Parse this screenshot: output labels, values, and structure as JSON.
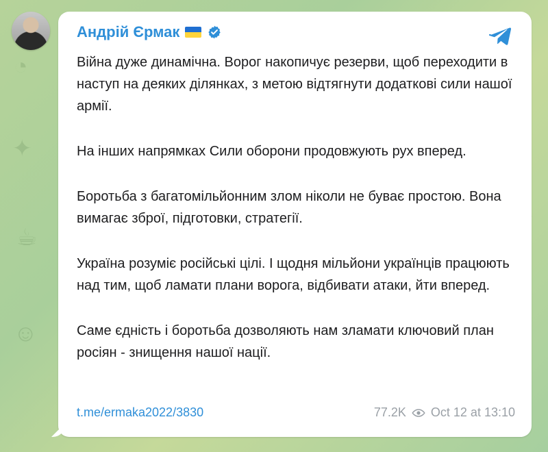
{
  "post": {
    "author": "Андрій Єрмак",
    "message": {
      "p1": "Війна дуже динамічна. Ворог накопичує резерви, щоб переходити в наступ на деяких ділянках, з метою відтягнути додаткові сили нашої армії.",
      "p2": "На інших напрямках Сили оборони продовжують рух вперед.",
      "p3": "Боротьба з багатомільйонним злом ніколи не буває простою. Вона вимагає зброї, підготовки, стратегії.",
      "p4": "Україна розуміє російські цілі. І щодня мільйони українців працюють над тим, щоб ламати плани ворога, відбивати атаки, йти вперед.",
      "p5": "Саме єдність і боротьба дозволяють нам зламати ключовий план росіян - знищення нашої нації."
    },
    "link": "t.me/ermaka2022/3830",
    "views": "77.2K",
    "timestamp": "Oct 12 at 13:10",
    "colors": {
      "author": "#2f8fd8",
      "link": "#2f8fd8",
      "text": "#1d1d1f",
      "meta": "#9aa0a6",
      "flag_blue": "#1f6fd1",
      "flag_yellow": "#ffd43b",
      "telegram": "#2f8fd8",
      "verified": "#2f8fd8"
    },
    "icons": {
      "avatar": "avatar",
      "flag": "ukraine-flag-icon",
      "verified": "verified-icon",
      "telegram": "telegram-icon",
      "views": "eye-icon"
    }
  }
}
